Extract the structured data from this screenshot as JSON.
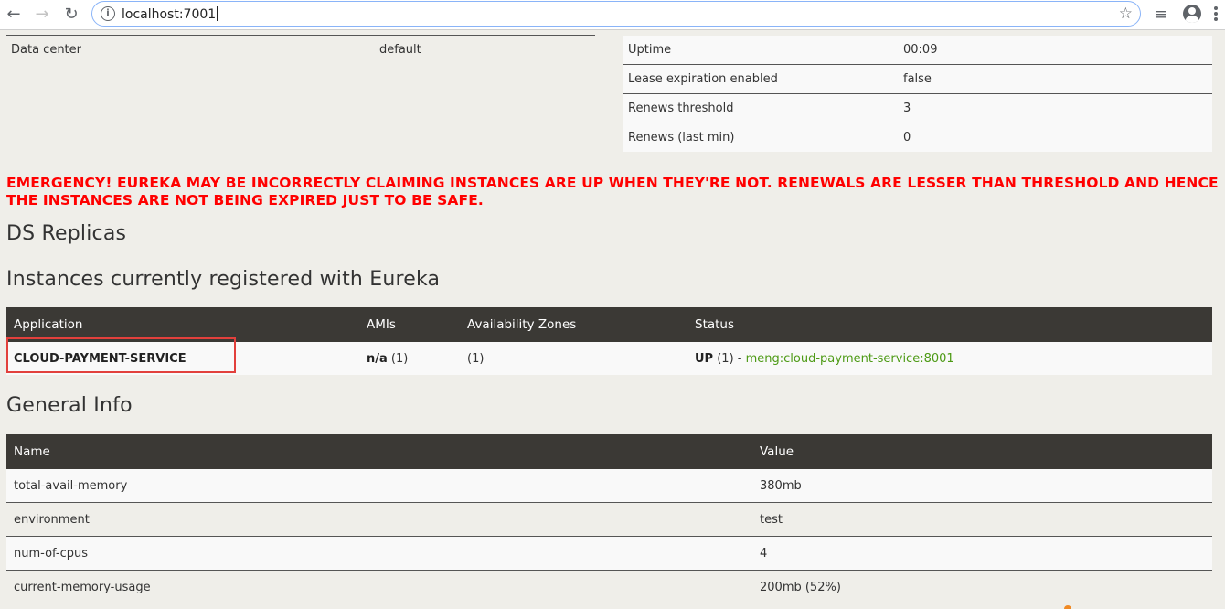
{
  "browser": {
    "url": "localhost:7001",
    "icons": {
      "back": "arrow-left-icon",
      "forward": "arrow-right-icon",
      "reload": "reload-icon",
      "info": "info-icon",
      "bookmark": "star-icon",
      "media": "media-queue-icon",
      "profile": "account-icon",
      "menu": "kebab-menu-icon"
    }
  },
  "system_left": {
    "rows": [
      {
        "label": "Data center",
        "value": "default"
      }
    ]
  },
  "system_right": {
    "rows": [
      {
        "label": "Uptime",
        "value": "00:09"
      },
      {
        "label": "Lease expiration enabled",
        "value": "false"
      },
      {
        "label": "Renews threshold",
        "value": "3"
      },
      {
        "label": "Renews (last min)",
        "value": "0"
      }
    ]
  },
  "emergency": {
    "text": "EMERGENCY! EUREKA MAY BE INCORRECTLY CLAIMING INSTANCES ARE UP WHEN THEY'RE NOT. RENEWALS ARE LESSER THAN THRESHOLD AND HENCE THE INSTANCES ARE NOT BEING EXPIRED JUST TO BE SAFE.",
    "color": "#ff0000"
  },
  "ds_replicas": {
    "title": "DS Replicas"
  },
  "instances": {
    "title": "Instances currently registered with Eureka",
    "headers": [
      "Application",
      "AMIs",
      "Availability Zones",
      "Status"
    ],
    "rows": [
      {
        "application": "CLOUD-PAYMENT-SERVICE",
        "amis_bold": "n/a",
        "amis_count": " (1)",
        "zones": "(1)",
        "status_bold": "UP",
        "status_count": " (1) - ",
        "status_link": "meng:cloud-payment-service:8001"
      }
    ]
  },
  "general_info": {
    "title": "General Info",
    "headers": [
      "Name",
      "Value"
    ],
    "rows": [
      {
        "name": "total-avail-memory",
        "value": "380mb"
      },
      {
        "name": "environment",
        "value": "test"
      },
      {
        "name": "num-of-cpus",
        "value": "4"
      },
      {
        "name": "current-memory-usage",
        "value": "200mb (52%)"
      }
    ]
  },
  "colors": {
    "header_bg": "#3b3935",
    "page_bg": "#efeee9",
    "link": "#4d9a15",
    "highlight_box": "#e2403c"
  }
}
